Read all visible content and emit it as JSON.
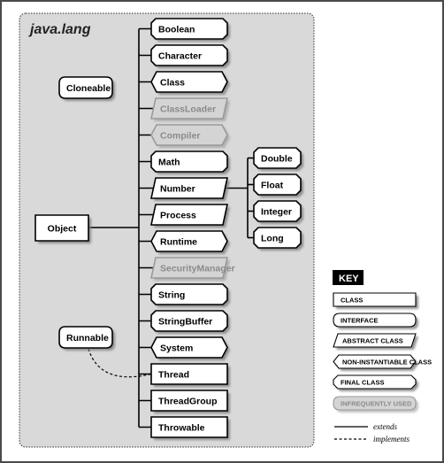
{
  "package": {
    "name": "java.lang"
  },
  "root": {
    "name": "Object",
    "kind": "class"
  },
  "interfaces": [
    {
      "name": "Cloneable",
      "kind": "interface"
    },
    {
      "name": "Runnable",
      "kind": "interface"
    }
  ],
  "subclasses_of_object": [
    {
      "name": "Boolean",
      "kind": "final"
    },
    {
      "name": "Character",
      "kind": "final"
    },
    {
      "name": "Class",
      "kind": "non-instantiable"
    },
    {
      "name": "ClassLoader",
      "kind": "abstract",
      "infrequent": true
    },
    {
      "name": "Compiler",
      "kind": "non-instantiable",
      "infrequent": true
    },
    {
      "name": "Math",
      "kind": "final"
    },
    {
      "name": "Number",
      "kind": "abstract"
    },
    {
      "name": "Process",
      "kind": "abstract"
    },
    {
      "name": "Runtime",
      "kind": "non-instantiable"
    },
    {
      "name": "SecurityManager",
      "kind": "abstract",
      "infrequent": true
    },
    {
      "name": "String",
      "kind": "final"
    },
    {
      "name": "StringBuffer",
      "kind": "final"
    },
    {
      "name": "System",
      "kind": "non-instantiable"
    },
    {
      "name": "Thread",
      "kind": "class",
      "implements": "Runnable"
    },
    {
      "name": "ThreadGroup",
      "kind": "class"
    },
    {
      "name": "Throwable",
      "kind": "class"
    }
  ],
  "subclasses_of_number": [
    {
      "name": "Double",
      "kind": "final"
    },
    {
      "name": "Float",
      "kind": "final"
    },
    {
      "name": "Integer",
      "kind": "final"
    },
    {
      "name": "Long",
      "kind": "final"
    }
  ],
  "key": {
    "title": "KEY",
    "items": [
      {
        "label": "CLASS",
        "kind": "class"
      },
      {
        "label": "INTERFACE",
        "kind": "interface"
      },
      {
        "label": "ABSTRACT CLASS",
        "kind": "abstract"
      },
      {
        "label": "NON-INSTANTIABLE CLASS",
        "kind": "non-instantiable"
      },
      {
        "label": "FINAL CLASS",
        "kind": "final"
      },
      {
        "label": "INFREQUENTLY USED",
        "kind": "interface",
        "infrequent": true
      }
    ],
    "lines": [
      {
        "label": "extends",
        "style": "solid"
      },
      {
        "label": "implements",
        "style": "dashed"
      }
    ]
  },
  "colors": {
    "package_bg": "#d9d9d9",
    "box_fill": "#ffffff",
    "box_stroke": "#000000",
    "infrequent_fill": "#d4d4d4",
    "infrequent_stroke": "#9a9a9a",
    "infrequent_text": "#8a8a8a",
    "shadow": "#7a7a7a",
    "key_title_bg": "#000000",
    "key_title_text": "#ffffff"
  }
}
